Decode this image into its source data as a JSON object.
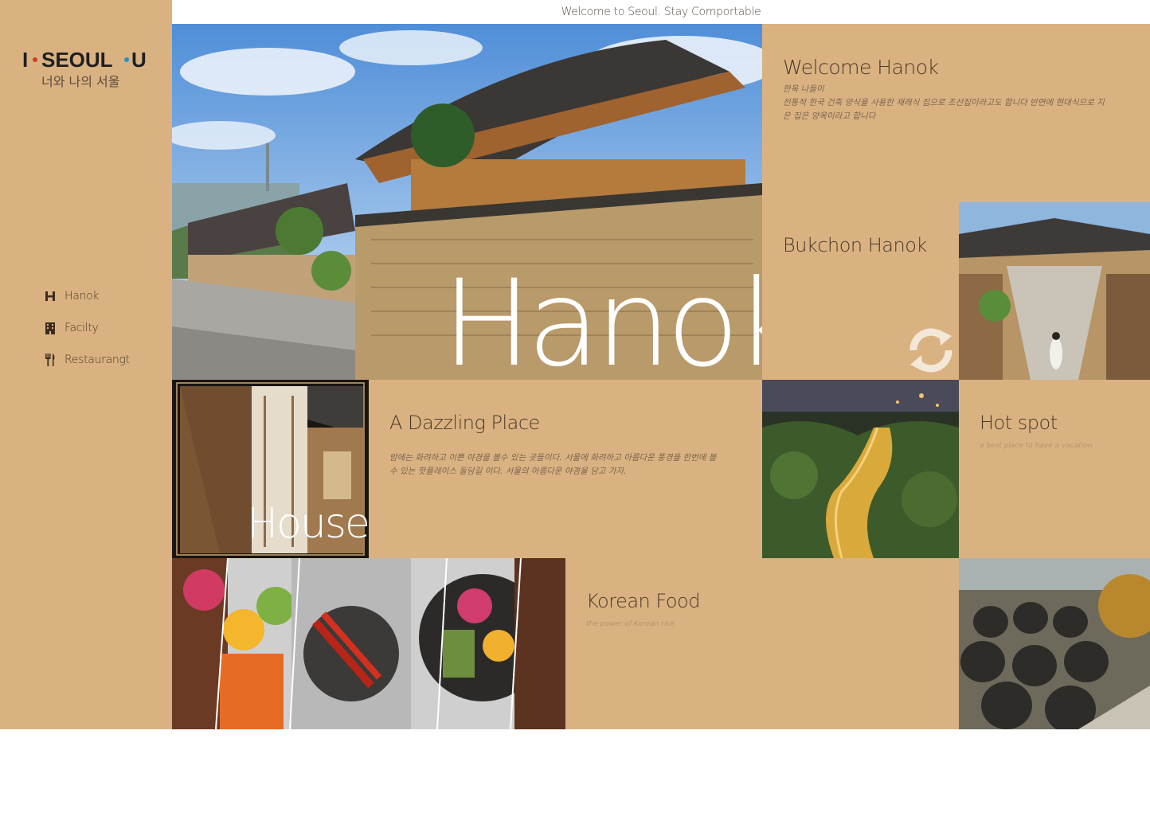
{
  "topbar": {
    "welcome": "Welcome to Seoul. Stay Comportable"
  },
  "logo": {
    "main": "I·SEOUL·U",
    "sub": "너와 나의 서울"
  },
  "nav": [
    {
      "label": "Hanok",
      "icon": "h-icon"
    },
    {
      "label": "Facilty",
      "icon": "building-icon"
    },
    {
      "label": "Restaurangt",
      "icon": "utensils-icon"
    }
  ],
  "hero": {
    "caption": "Hanok"
  },
  "welcome": {
    "title": "Welcome Hanok",
    "line1": "한옥 나들이",
    "line2": "전통적 한국 건축 양식을 사용한 재래식 집으로 조선집이라고도 합니다 반면에 현대식으로 지",
    "line3": "은 집은 양옥이라고 합니다"
  },
  "bukchon": {
    "title": "Bukchon Hanok"
  },
  "house": {
    "caption": "House"
  },
  "dazzling": {
    "title": "A Dazzling Place",
    "line1": "밤에는 화려하고 이쁜 야경을 볼수 있는 곳들이다. 서울에 화려하고 아름다운 풍경을 한번에 볼",
    "line2": "수 있는 핫플레이스 돌담길 이다. 서울의 아름다운 야경을 담고 가자."
  },
  "hotspot": {
    "title": "Hot spot",
    "sub": "a best place to have a vacation"
  },
  "food": {
    "title": "Korean Food",
    "sub": "the power of Korean rice"
  },
  "colors": {
    "tan": "#dab282",
    "text": "#4a3a2a",
    "white": "#ffffff"
  }
}
